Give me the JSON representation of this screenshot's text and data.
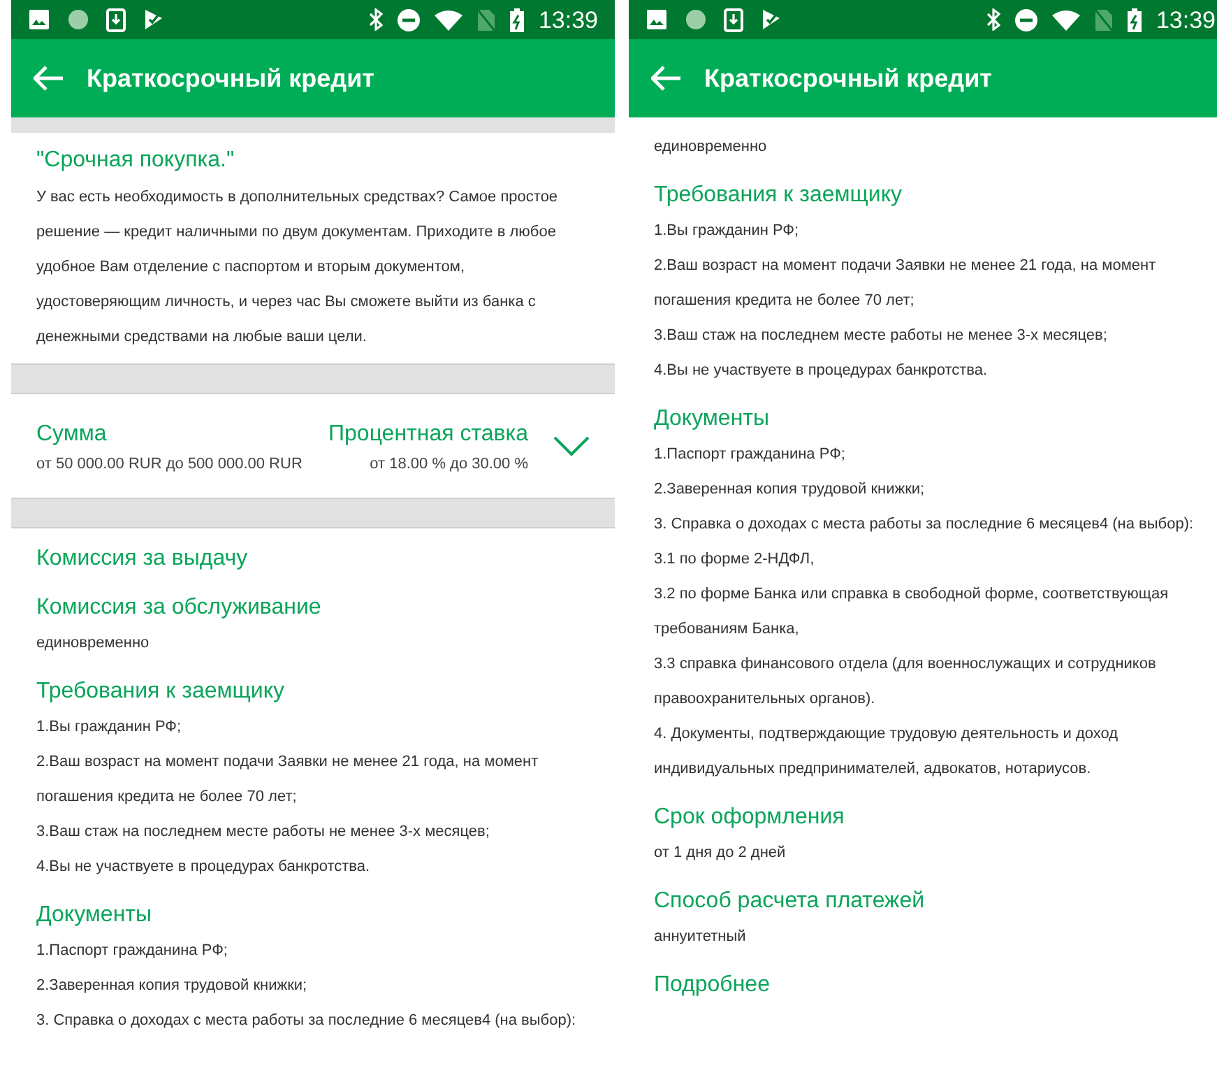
{
  "screens": [
    {
      "status_bar": {
        "time": "13:39"
      },
      "title": "Краткосрочный кредит",
      "intro": {
        "heading": "\"Срочная покупка.\"",
        "text": "У вас есть необходимость в дополнительных средствах? Самое простое решение — кредит наличными по двум документам. Приходите в любое удобное Вам отделение с паспортом и вторым документом, удостоверяющим личность, и через час Вы сможете выйти из банка с денежными средствами на любые ваши цели."
      },
      "summary": {
        "amount_label": "Сумма",
        "amount": "от 50 000.00 RUR до 500 000.00 RUR",
        "rate_label": "Процентная ставка",
        "rate": "от 18.00 % до 30.00 %"
      },
      "sections": [
        {
          "heading": "Комиссия за выдачу"
        },
        {
          "heading": "Комиссия за обслуживание",
          "lines": [
            "единовременно"
          ]
        },
        {
          "heading": "Требования к заемщику",
          "lines": [
            "1.Вы гражданин РФ;",
            "2.Ваш возраст на момент подачи Заявки не менее 21 года, на момент погашения кредита не более 70 лет;",
            "3.Ваш стаж на последнем месте работы не менее 3-х месяцев;",
            "4.Вы не участвуете в процедурах банкротства."
          ]
        },
        {
          "heading": "Документы",
          "lines": [
            "1.Паспорт гражданина РФ;",
            "2.Заверенная копия трудовой книжки;",
            "3. Справка о доходах с места работы за последние 6 месяцев4 (на выбор):"
          ]
        }
      ]
    },
    {
      "status_bar": {
        "time": "13:39"
      },
      "title": "Краткосрочный кредит",
      "sections": [
        {
          "lines": [
            "единовременно"
          ]
        },
        {
          "heading": "Требования к заемщику",
          "lines": [
            "1.Вы гражданин РФ;",
            "2.Ваш возраст на момент подачи Заявки не менее 21 года, на момент погашения кредита не более 70 лет;",
            "3.Ваш стаж на последнем месте работы не менее 3-х месяцев;",
            "4.Вы не участвуете в процедурах банкротства."
          ]
        },
        {
          "heading": "Документы",
          "lines": [
            "1.Паспорт гражданина РФ;",
            "2.Заверенная копия трудовой книжки;",
            "3. Справка о доходах с места работы за последние 6 месяцев4 (на выбор):",
            "3.1 по форме 2-НДФЛ,",
            "3.2 по форме Банка или справка в свободной форме, соответствующая требованиям Банка,",
            "3.3 справка финансового отдела (для военнослужащих и сотрудников правоохранительных органов).",
            "4. Документы, подтверждающие трудовую деятельность и доход индивидуальных предпринимателей, адвокатов, нотариусов."
          ]
        },
        {
          "heading": "Срок оформления",
          "lines": [
            "от 1 дня до 2 дней"
          ]
        },
        {
          "heading": "Способ расчета платежей",
          "lines": [
            "аннуитетный"
          ]
        },
        {
          "heading": "Подробнее"
        }
      ]
    }
  ]
}
